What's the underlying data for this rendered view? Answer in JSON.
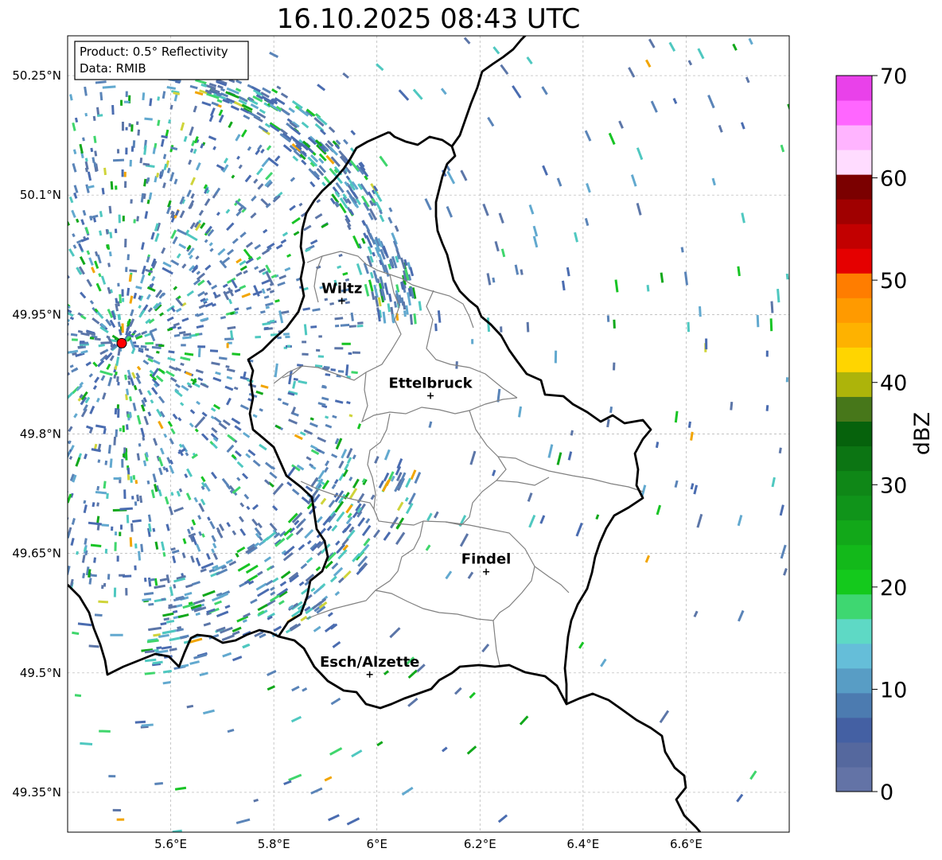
{
  "title": "16.10.2025 08:43 UTC",
  "info_box": {
    "product": "Product: 0.5° Reflectivity",
    "data": "Data: RMIB"
  },
  "map_extent": {
    "lon_min": 5.4,
    "lon_max": 6.8,
    "lat_min": 49.3,
    "lat_max": 50.3
  },
  "lat_ticks": [
    {
      "value": 50.25,
      "label": "50.25°N"
    },
    {
      "value": 50.1,
      "label": "50.1°N"
    },
    {
      "value": 49.95,
      "label": "49.95°N"
    },
    {
      "value": 49.8,
      "label": "49.8°N"
    },
    {
      "value": 49.65,
      "label": "49.65°N"
    },
    {
      "value": 49.5,
      "label": "49.5°N"
    },
    {
      "value": 49.35,
      "label": "49.35°N"
    }
  ],
  "lon_ticks": [
    {
      "value": 5.6,
      "label": "5.6°E"
    },
    {
      "value": 5.8,
      "label": "5.8°E"
    },
    {
      "value": 6.0,
      "label": "6°E"
    },
    {
      "value": 6.2,
      "label": "6.2°E"
    },
    {
      "value": 6.4,
      "label": "6.4°E"
    },
    {
      "value": 6.6,
      "label": "6.6°E"
    }
  ],
  "radar_site": {
    "lon": 5.505,
    "lat": 49.914,
    "color": "#ff0000"
  },
  "cities": [
    {
      "name": "Wiltz",
      "lon": 5.932,
      "lat": 49.967
    },
    {
      "name": "Ettelbruck",
      "lon": 6.104,
      "lat": 49.848
    },
    {
      "name": "Findel",
      "lon": 6.212,
      "lat": 49.627
    },
    {
      "name": "Esch/Alzette",
      "lon": 5.986,
      "lat": 49.498
    }
  ],
  "colorbar": {
    "label": "dBZ",
    "min": 0,
    "max": 70,
    "ticks": [
      "0",
      "10",
      "20",
      "30",
      "40",
      "50",
      "60",
      "70"
    ],
    "colors": [
      "#6373a6",
      "#55689e",
      "#4460a3",
      "#4c7bb0",
      "#589dc5",
      "#65bed9",
      "#5ed9c5",
      "#3ed771",
      "#14c91c",
      "#13b91a",
      "#12a819",
      "#10941a",
      "#0f8717",
      "#0c7513",
      "#06620c",
      "#47771a",
      "#adb40a",
      "#ffd500",
      "#feb200",
      "#ff9a00",
      "#ff7d00",
      "#e50000",
      "#c20000",
      "#a00000",
      "#7b0000",
      "#ffdcff",
      "#ffb4ff",
      "#ff66ff",
      "#e941ea"
    ]
  },
  "reflectivity_palette": [
    "#5c76a8",
    "#4a6cb0",
    "#5a84b8",
    "#62a9cf",
    "#4fc8c0",
    "#3fd66c",
    "#18c425",
    "#11a81b",
    "#cfd43a",
    "#f2a500"
  ]
}
